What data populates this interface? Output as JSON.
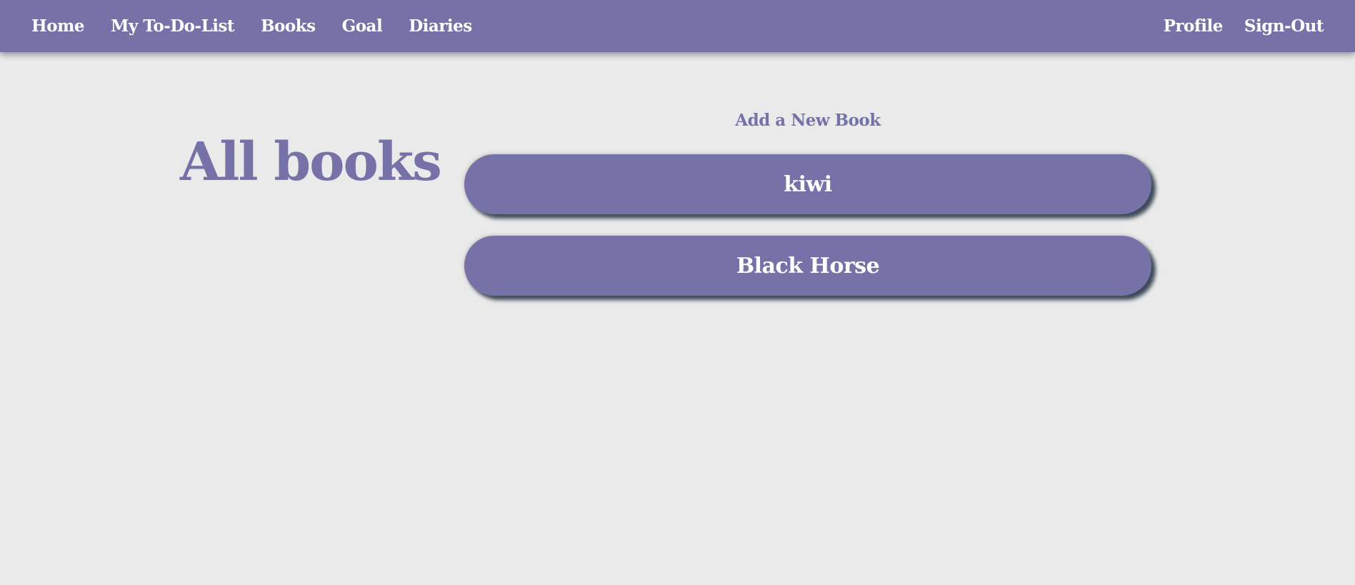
{
  "nav": {
    "left": [
      {
        "name": "nav-home",
        "label": "Home"
      },
      {
        "name": "nav-todo-list",
        "label": "My To-Do-List"
      },
      {
        "name": "nav-books",
        "label": "Books"
      },
      {
        "name": "nav-goal",
        "label": "Goal"
      },
      {
        "name": "nav-diaries",
        "label": "Diaries"
      }
    ],
    "right": [
      {
        "name": "nav-profile",
        "label": "Profile"
      },
      {
        "name": "nav-sign-out",
        "label": "Sign-Out"
      }
    ]
  },
  "main": {
    "title": "All books",
    "add_book_label": "Add a New Book",
    "books": [
      {
        "title": "kiwi"
      },
      {
        "title": "Black Horse"
      }
    ]
  },
  "colors": {
    "accent": "#7672a7",
    "background": "#eaeaea",
    "card_text": "#ffffff",
    "card_shadow": "#3d4a58"
  }
}
